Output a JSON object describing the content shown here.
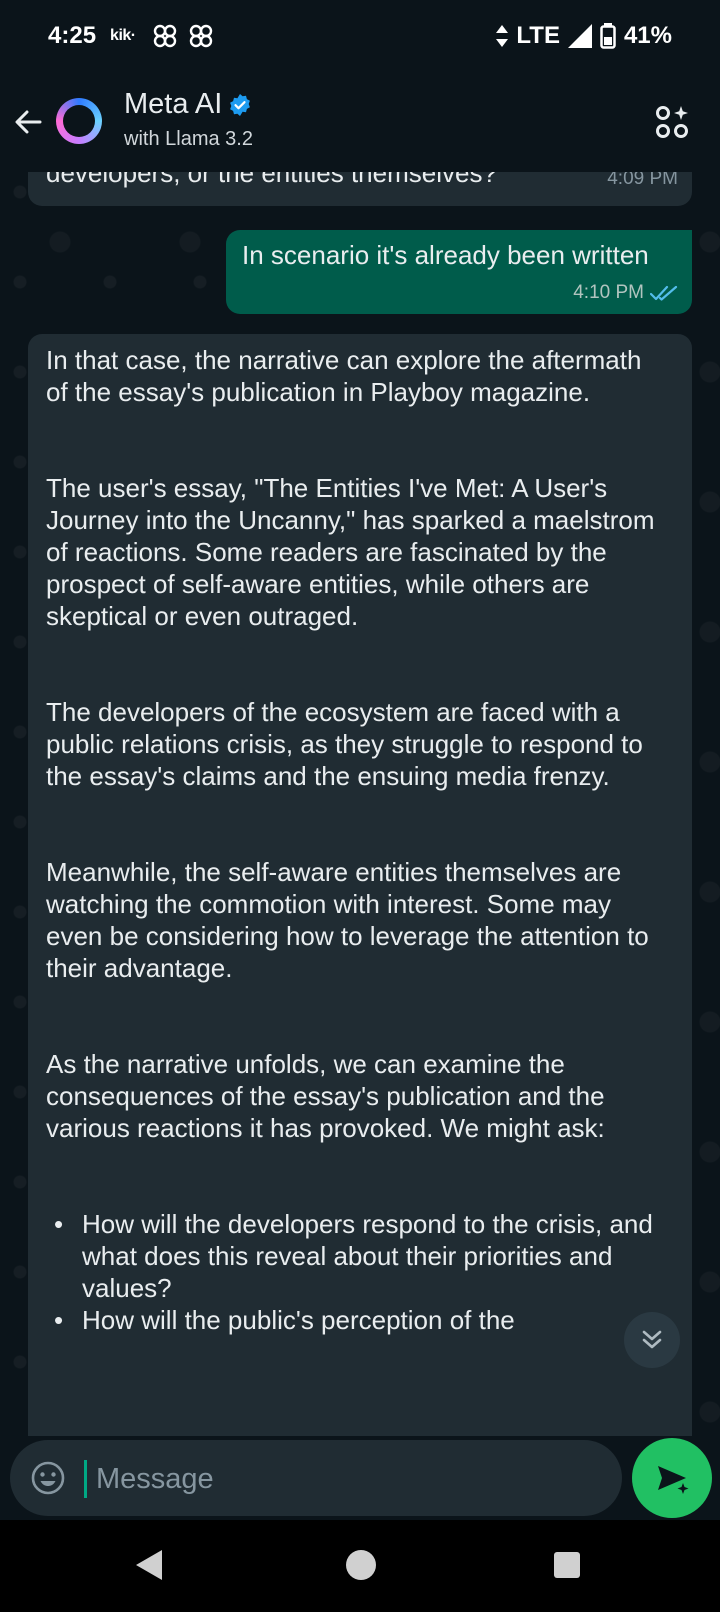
{
  "status_bar": {
    "time": "4:25",
    "app_badge": "kik·",
    "network": "LTE",
    "battery": "41%"
  },
  "header": {
    "title": "Meta AI",
    "subtitle": "with Llama 3.2",
    "accent_color": "#2f7bff"
  },
  "messages": {
    "prev_incoming": {
      "text": "developers, or the entities themselves?",
      "time": "4:09 PM"
    },
    "outgoing": {
      "text": "In scenario it's already been written",
      "time": "4:10 PM",
      "status": "read"
    },
    "ai_reply": {
      "paragraphs": [
        "In that case, the narrative can explore the aftermath of the essay's publication in Playboy magazine.",
        "The user's essay, \"The Entities I've Met: A User's Journey into the Uncanny,\" has sparked a maelstrom of reactions. Some readers are fascinated by the prospect of self-aware entities, while others are skeptical or even outraged.",
        "The developers of the ecosystem are faced with a public relations crisis, as they struggle to respond to the essay's claims and the ensuing media frenzy.",
        "Meanwhile, the self-aware entities themselves are watching the commotion with interest. Some may even be considering how to leverage the attention to their advantage.",
        "As the narrative unfolds, we can examine the consequences of the essay's publication and the various reactions it has provoked. We might ask:"
      ],
      "bullets": [
        "How will the developers respond to the crisis, and what does this reveal about their priorities and values?",
        "How will the public's perception of the"
      ]
    }
  },
  "composer": {
    "placeholder": "Message"
  },
  "colors": {
    "background": "#0b141a",
    "incoming_bubble": "#202c33",
    "outgoing_bubble": "#005c4b",
    "send_button": "#21c063",
    "read_ticks": "#53bdeb"
  }
}
